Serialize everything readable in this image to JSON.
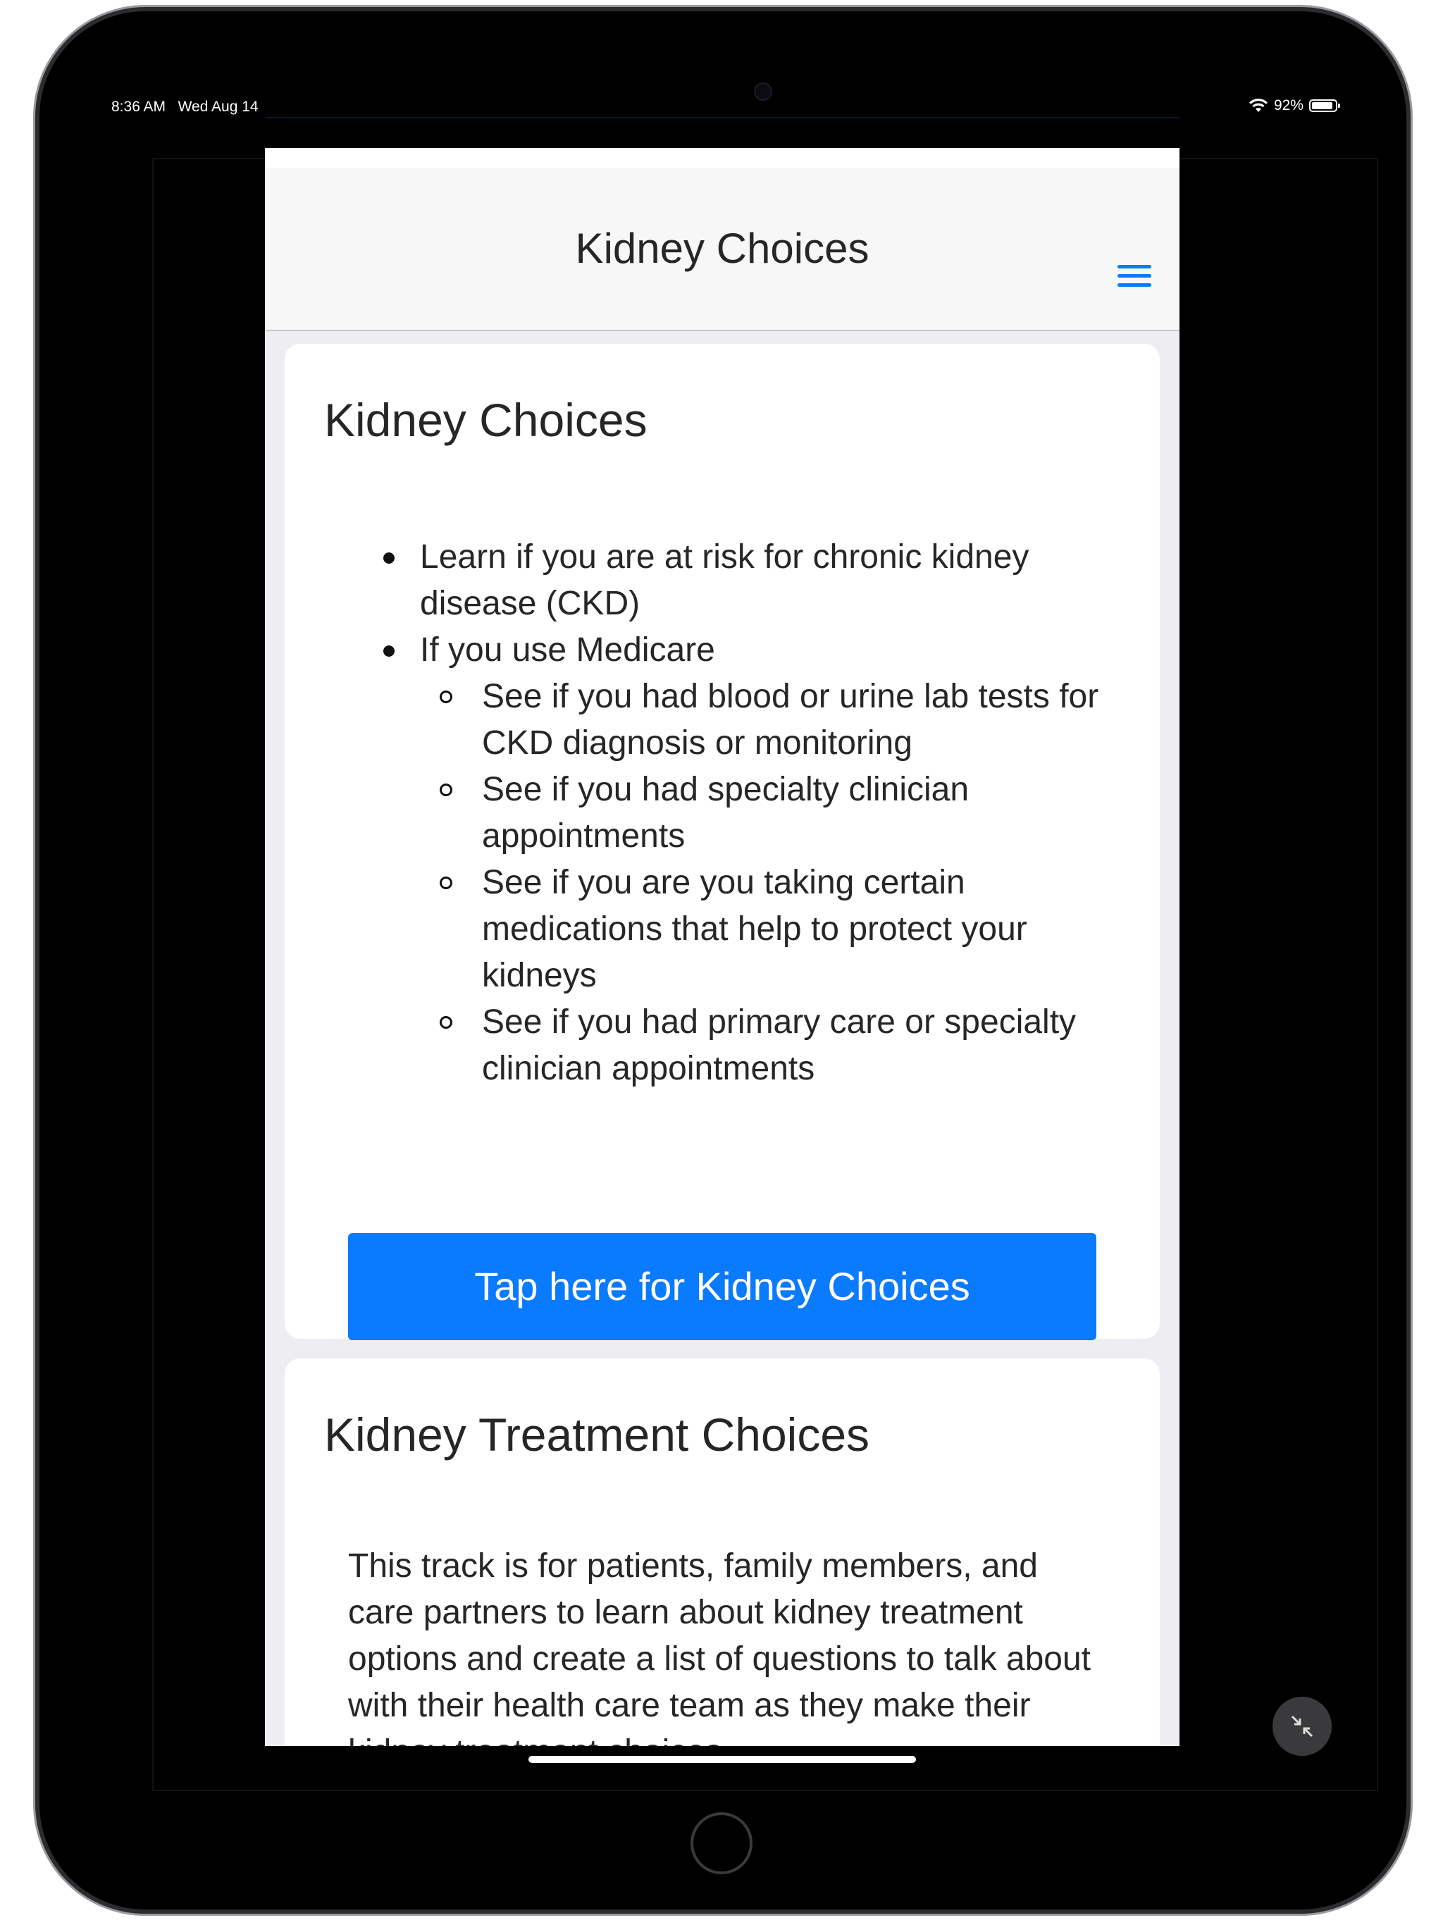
{
  "status_bar": {
    "time": "8:36 AM",
    "date": "Wed Aug 14",
    "battery_percent": "92%",
    "battery_level": 0.92
  },
  "navbar": {
    "title": "Kidney Choices",
    "menu_icon": "hamburger-menu-icon",
    "accent_color": "#0a7aff"
  },
  "cards": [
    {
      "title": "Kidney Choices",
      "items": [
        {
          "text": "Learn if you are at risk for chronic kidney disease (CKD)"
        },
        {
          "text": "If you use Medicare",
          "subitems": [
            "See if you had blood or urine lab tests for CKD diagnosis or monitoring",
            "See if you had specialty clinician appointments",
            "See if you are you taking certain medications that help to protect your kidneys",
            "See if you had primary care or specialty clinician appointments"
          ]
        }
      ],
      "button_label": "Tap here for Kidney Choices"
    },
    {
      "title": "Kidney Treatment Choices",
      "body": "This track is for patients, family members, and care partners to learn about kidney treatment options and create a list of questions to talk about with their health care team as they make their kidney treatment choices."
    }
  ]
}
